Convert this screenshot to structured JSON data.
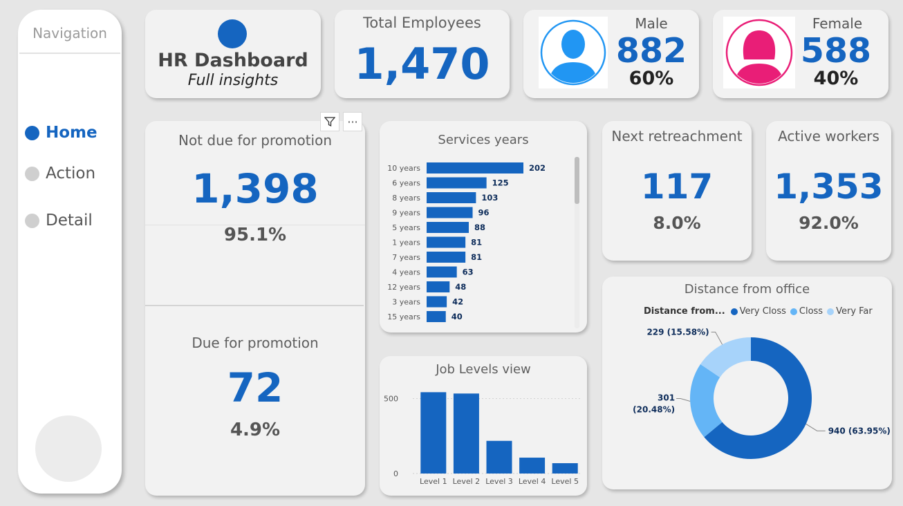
{
  "nav": {
    "title": "Navigation",
    "items": [
      {
        "label": "Home",
        "active": true
      },
      {
        "label": "Action",
        "active": false
      },
      {
        "label": "Detail",
        "active": false
      }
    ]
  },
  "header": {
    "title": "HR Dashboard",
    "subtitle": "Full insights"
  },
  "total": {
    "title": "Total Employees",
    "value": "1,470"
  },
  "male": {
    "title": "Male",
    "value": "882",
    "pct": "60%",
    "icon": "male-avatar-icon",
    "color": "#2196f3"
  },
  "female": {
    "title": "Female",
    "value": "588",
    "pct": "40%",
    "icon": "female-avatar-icon",
    "color": "#e91e77"
  },
  "not_due": {
    "title": "Not due for promotion",
    "value": "1,398",
    "pct": "95.1%"
  },
  "due": {
    "title": "Due for promotion",
    "value": "72",
    "pct": "4.9%"
  },
  "visual_toolbar": {
    "filter_icon": "filter-icon",
    "more_label": "···"
  },
  "next_retrenchment": {
    "title": "Next retreachment",
    "value": "117",
    "pct": "8.0%"
  },
  "active_workers": {
    "title": "Active workers",
    "value": "1,353",
    "pct": "92.0%"
  },
  "accent": "#1565c0",
  "chart_data": [
    {
      "type": "bar",
      "orientation": "horizontal",
      "title": "Services years",
      "categories": [
        "10 years",
        "6 years",
        "8 years",
        "9 years",
        "5 years",
        "1 years",
        "7 years",
        "4 years",
        "12 years",
        "3 years",
        "15 years"
      ],
      "values": [
        202,
        125,
        103,
        96,
        88,
        81,
        81,
        63,
        48,
        42,
        40
      ],
      "data_labels": true,
      "color": "#1565c0"
    },
    {
      "type": "bar",
      "title": "Job Levels view",
      "categories": [
        "Level 1",
        "Level 2",
        "Level 3",
        "Level 4",
        "Level 5"
      ],
      "values": [
        543,
        534,
        218,
        106,
        69
      ],
      "yticks": [
        0,
        500
      ],
      "ylim": [
        0,
        600
      ],
      "grid": true,
      "color": "#1565c0"
    },
    {
      "type": "pie",
      "donut": true,
      "title": "Distance from office",
      "legend_title": "Distance from...",
      "legend_position": "top",
      "slices": [
        {
          "name": "Very Closs",
          "value": 940,
          "label": "940 (63.95%)",
          "color": "#1565c0"
        },
        {
          "name": "Closs",
          "value": 301,
          "label": "301 (20.48%)",
          "color": "#64b5f6"
        },
        {
          "name": "Very Far",
          "value": 229,
          "label": "229 (15.58%)",
          "color": "#a7d3fa"
        }
      ]
    }
  ]
}
